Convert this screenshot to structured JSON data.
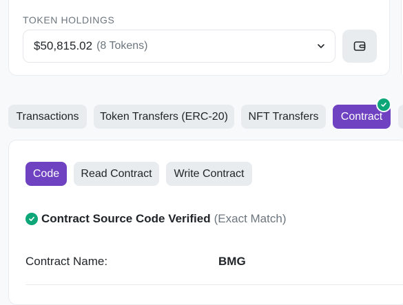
{
  "holdings": {
    "label": "TOKEN HOLDINGS",
    "value": "$50,815.02",
    "count": "(8 Tokens)"
  },
  "icons": {
    "dropdown": "chevron-down-icon",
    "wallet": "wallet-icon",
    "verified": "check-circle-icon"
  },
  "tabs": [
    {
      "label": "Transactions"
    },
    {
      "label": "Token Transfers (ERC-20)"
    },
    {
      "label": "NFT Transfers"
    },
    {
      "label": "Contract",
      "active": true
    }
  ],
  "contract": {
    "subtabs": [
      {
        "label": "Code",
        "active": true
      },
      {
        "label": "Read Contract"
      },
      {
        "label": "Write Contract"
      }
    ],
    "verified_title": "Contract Source Code Verified",
    "verified_note": "(Exact Match)",
    "name_label": "Contract Name:",
    "name_value": "BMG"
  },
  "colors": {
    "accent": "#6f42c1",
    "success": "#0ca678",
    "tab_bg": "#e9ecef",
    "muted_text": "#6c757d"
  }
}
